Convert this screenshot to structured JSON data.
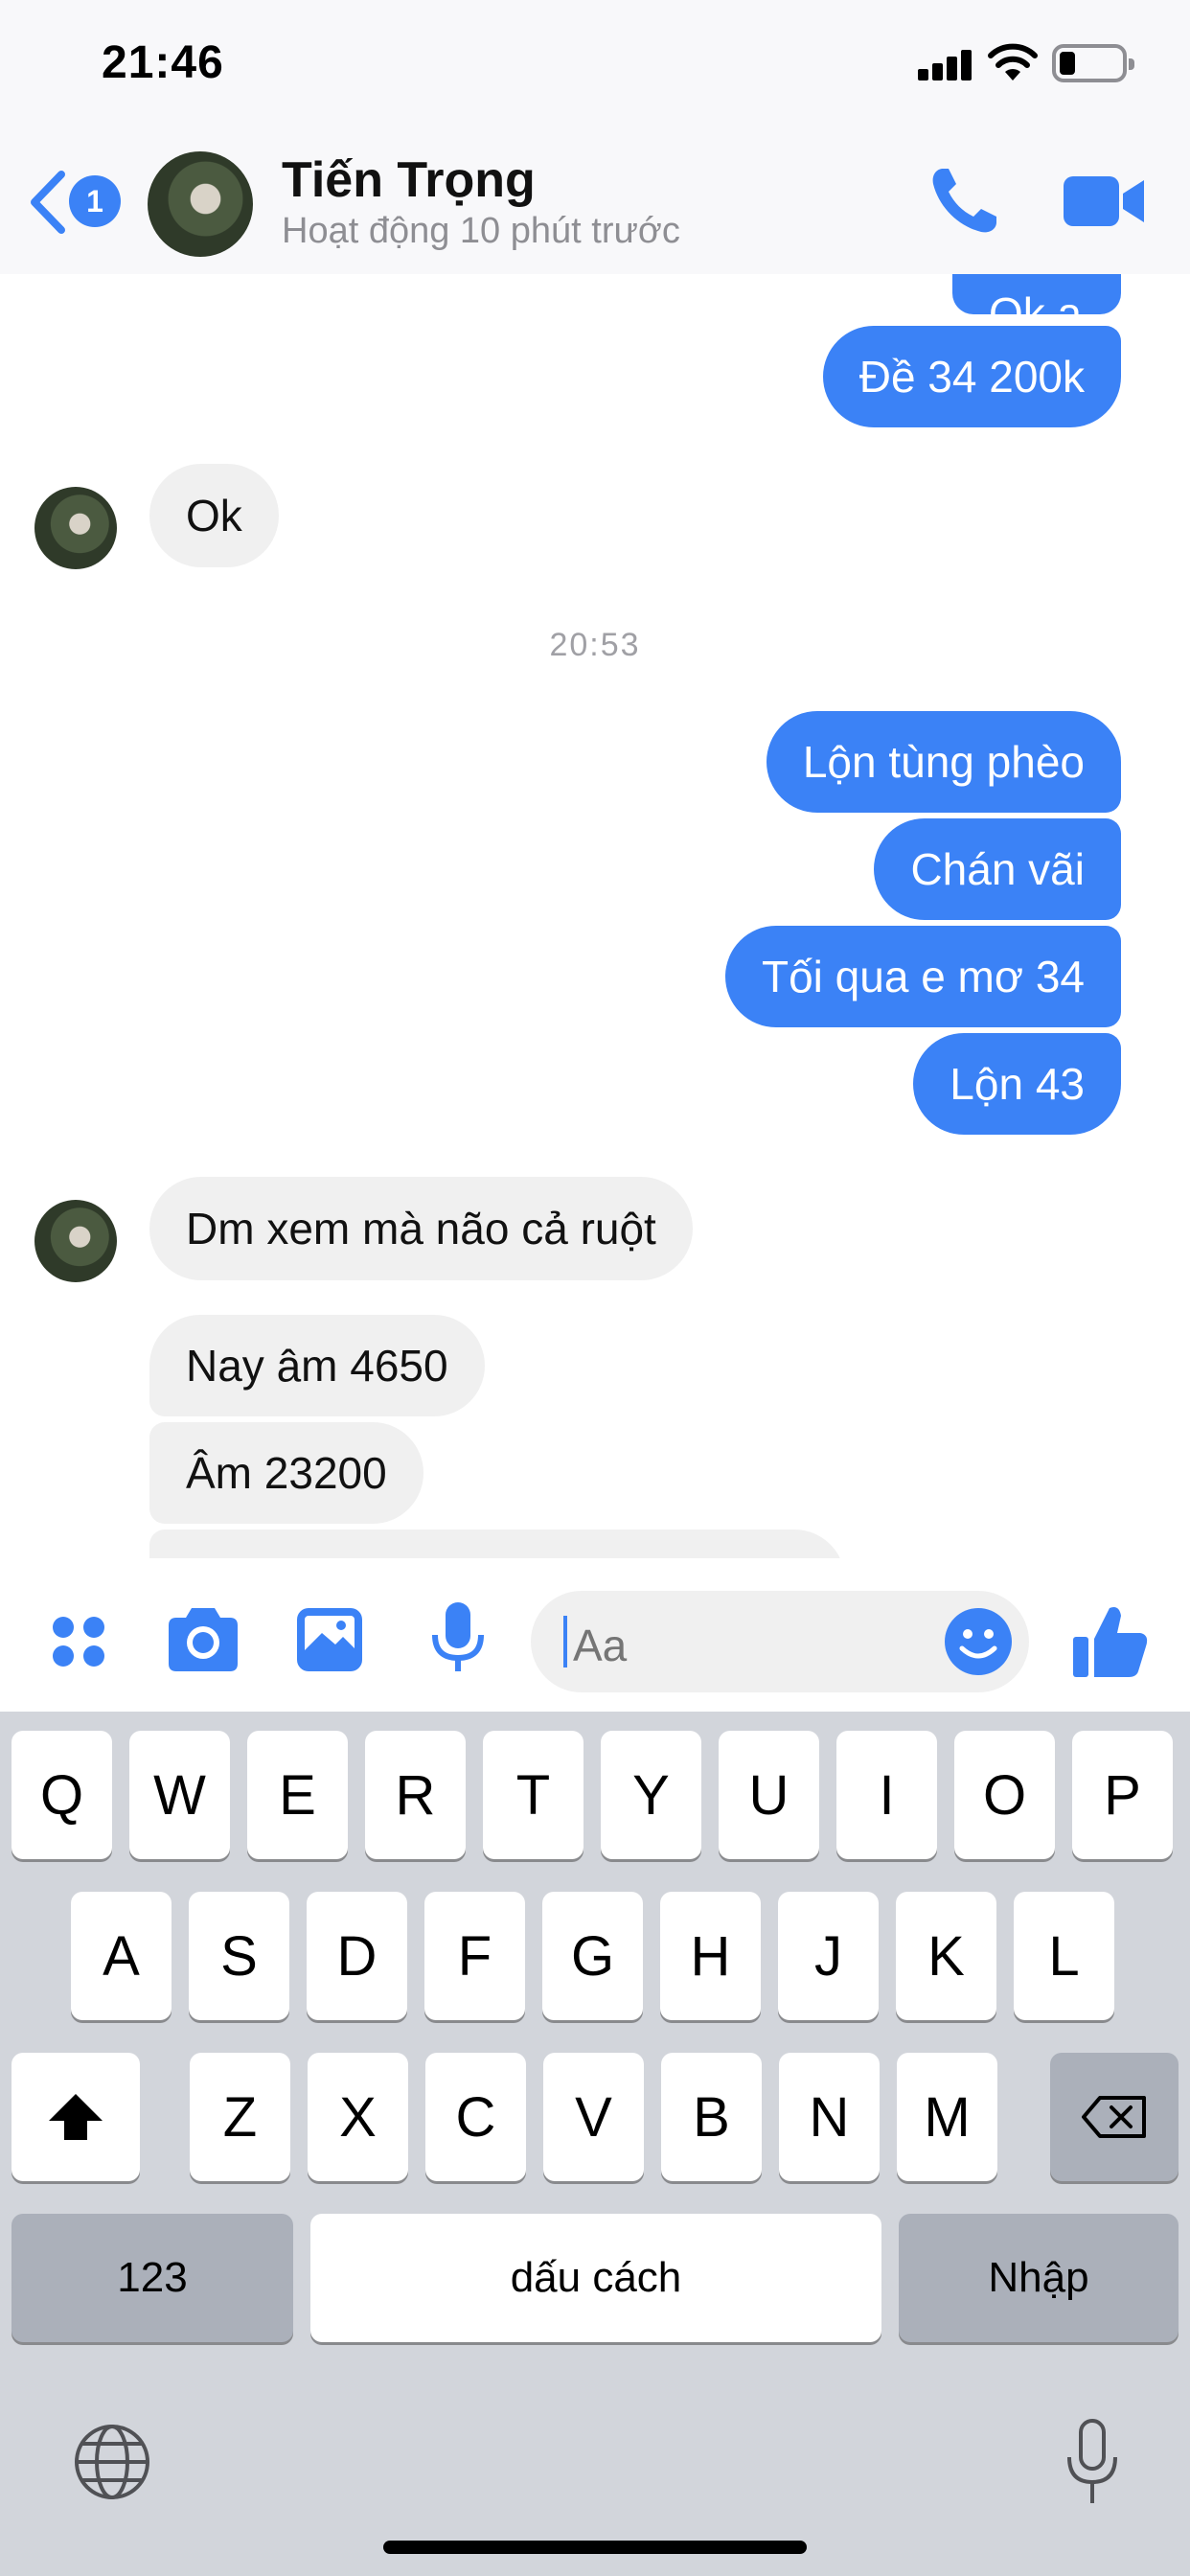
{
  "status_bar": {
    "time": "21:46"
  },
  "header": {
    "unread_count": "1",
    "contact_name": "Tiến Trọng",
    "contact_status": "Hoạt động 10 phút trước"
  },
  "messages": {
    "out_partial": "Ok a",
    "out_1": "Đề 34 200k",
    "in_1": "Ok",
    "timestamp": "20:53",
    "out_2": "Lộn tùng phèo",
    "out_3": "Chán vãi",
    "out_4": "Tối qua e mơ 34",
    "out_5": "Lộn 43",
    "in_2": "Dm xem mà não cả ruột",
    "in_3": "Nay âm 4650",
    "in_4": "Âm 23200"
  },
  "composer": {
    "placeholder": "Aa"
  },
  "keyboard": {
    "row1": [
      "Q",
      "W",
      "E",
      "R",
      "T",
      "Y",
      "U",
      "I",
      "O",
      "P"
    ],
    "row2": [
      "A",
      "S",
      "D",
      "F",
      "G",
      "H",
      "J",
      "K",
      "L"
    ],
    "row3": [
      "Z",
      "X",
      "C",
      "V",
      "B",
      "N",
      "M"
    ],
    "numbers_key": "123",
    "space_key": "dấu cách",
    "return_key": "Nhập"
  },
  "colors": {
    "accent": "#3b82f6",
    "incoming_bubble": "#f0f0f0",
    "keyboard_bg": "#d2d5db"
  }
}
